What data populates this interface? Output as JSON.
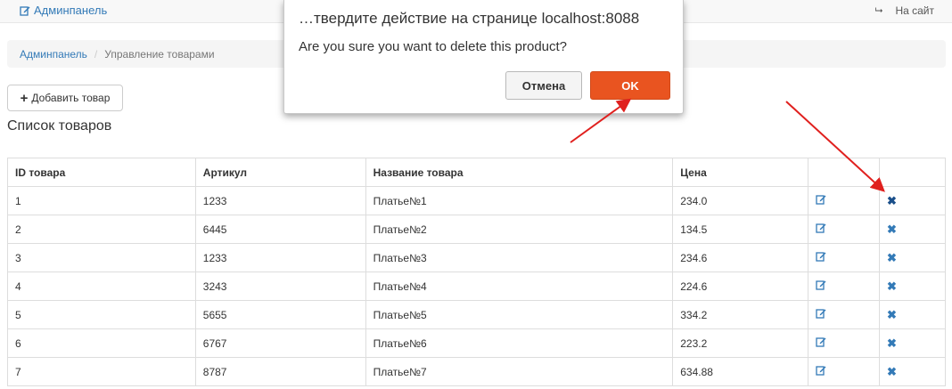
{
  "navbar": {
    "brand_label": "Админпанель",
    "site_link_label": "На сайт"
  },
  "breadcrumb": {
    "home": "Админпанель",
    "separator": "/",
    "current": "Управление товарами"
  },
  "toolbar": {
    "add_product_label": "Добавить товар"
  },
  "list_title": "Список товаров",
  "table": {
    "columns": [
      "ID товара",
      "Артикул",
      "Название товара",
      "Цена",
      "",
      ""
    ],
    "rows": [
      {
        "id": "1",
        "sku": "1233",
        "name": "Платье№1",
        "price": "234.0"
      },
      {
        "id": "2",
        "sku": "6445",
        "name": "Платье№2",
        "price": "134.5"
      },
      {
        "id": "3",
        "sku": "1233",
        "name": "Платье№3",
        "price": "234.6"
      },
      {
        "id": "4",
        "sku": "3243",
        "name": "Платье№4",
        "price": "224.6"
      },
      {
        "id": "5",
        "sku": "5655",
        "name": "Платье№5",
        "price": "334.2"
      },
      {
        "id": "6",
        "sku": "6767",
        "name": "Платье№6",
        "price": "223.2"
      },
      {
        "id": "7",
        "sku": "8787",
        "name": "Платье№7",
        "price": "634.88"
      }
    ]
  },
  "dialog": {
    "title": "…твердите действие на странице localhost:8088",
    "message": "Are you sure you want to delete this product?",
    "cancel_label": "Отмена",
    "ok_label": "OK"
  },
  "icons": {
    "brand": "edit-icon",
    "site_link": "sign-out-icon",
    "add": "plus-icon",
    "row_edit": "edit-icon",
    "row_delete": "remove-icon"
  },
  "colors": {
    "link": "#337ab7",
    "ok_button": "#e95420",
    "arrow": "#e0201e"
  }
}
